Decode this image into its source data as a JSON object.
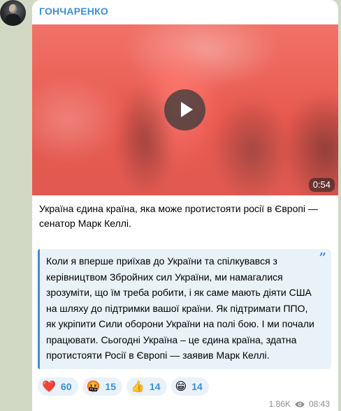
{
  "channel": {
    "name": "ГОНЧАРЕНКО"
  },
  "video": {
    "duration": "0:54"
  },
  "post": {
    "caption": "Україна єдина країна, яка може протистояти росії в Європі — сенатор Марк Келлі.",
    "quote_mark": "”",
    "quote": "Коли я вперше приїхав до України та спілкувався з керівництвом Збройних сил України, ми намагалися зрозуміти, що їм треба робити, і як саме мають діяти США на шляху до підтримки вашої країни. Як підтримати ППО, як укріпити Сили оборони України на полі бою. І ми почали працювати. Сьогодні Україна – це єдина країна, здатна протистояти Росії в Європі — заявив Марк Келлі."
  },
  "reactions": [
    {
      "emoji": "❤️",
      "icon": "heart-icon",
      "count": "60"
    },
    {
      "emoji": "🤬",
      "icon": "angry-face-icon",
      "count": "15"
    },
    {
      "emoji": "👍",
      "icon": "thumbs-up-icon",
      "count": "14"
    },
    {
      "emoji": "😁",
      "icon": "grinning-face-icon",
      "count": "14"
    }
  ],
  "meta": {
    "views": "1.86K",
    "time": "08:43"
  },
  "colors": {
    "accent": "#3a8fd8",
    "background": "#d1d8c4",
    "quote_bg": "#e9f1f9"
  }
}
